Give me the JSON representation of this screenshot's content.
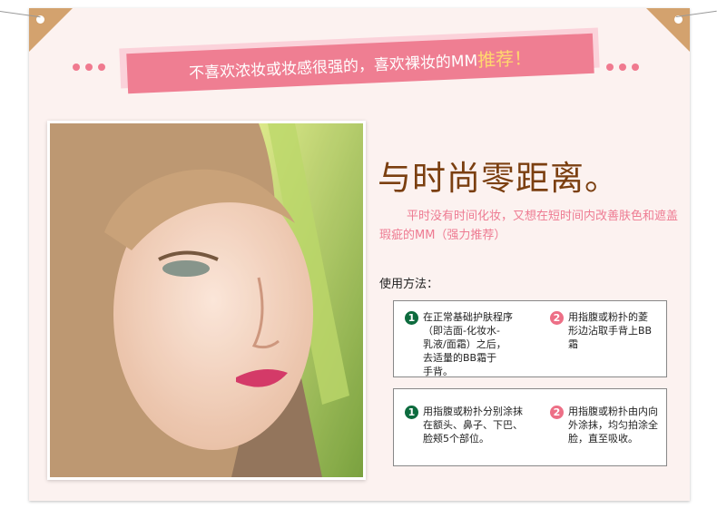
{
  "banner": {
    "text": "不喜欢浓妆或妆感很强的，喜欢裸妆的MM",
    "highlight": "推荐！"
  },
  "headline": "与时尚零距离。",
  "description": "平时没有时间化妆，又想在短时间内改善肤色和遮盖瑕疵的MM（强力推荐）",
  "usage_label": "使用方法：",
  "method_box_1": {
    "steps": [
      {
        "num": "1",
        "text": "在正常基础护肤程序\n（即洁面-化妆水-\n乳液/面霜）之后，\n去适量的BB霜于\n手背。"
      },
      {
        "num": "2",
        "text": "用指腹或粉扑的菱\n形边沾取手背上BB\n霜"
      }
    ]
  },
  "method_box_2": {
    "steps": [
      {
        "num": "1",
        "text": "用指腹或粉扑分别涂抹\n在额头、鼻子、下巴、\n脸颊5个部位。"
      },
      {
        "num": "2",
        "text": "用指腹或粉扑由内向\n外涂抹，均匀拍涂全\n脸，直至吸收。"
      }
    ]
  },
  "colors": {
    "banner": "#ef7e92",
    "banner_shadow": "#fbd2da",
    "corner": "#d3a26e",
    "headline": "#7b3f10",
    "description": "#ee7b92",
    "step_1_badge": "#0d6b3e",
    "step_2_badge": "#ed6f86",
    "card_background": "#fcf2f0"
  }
}
